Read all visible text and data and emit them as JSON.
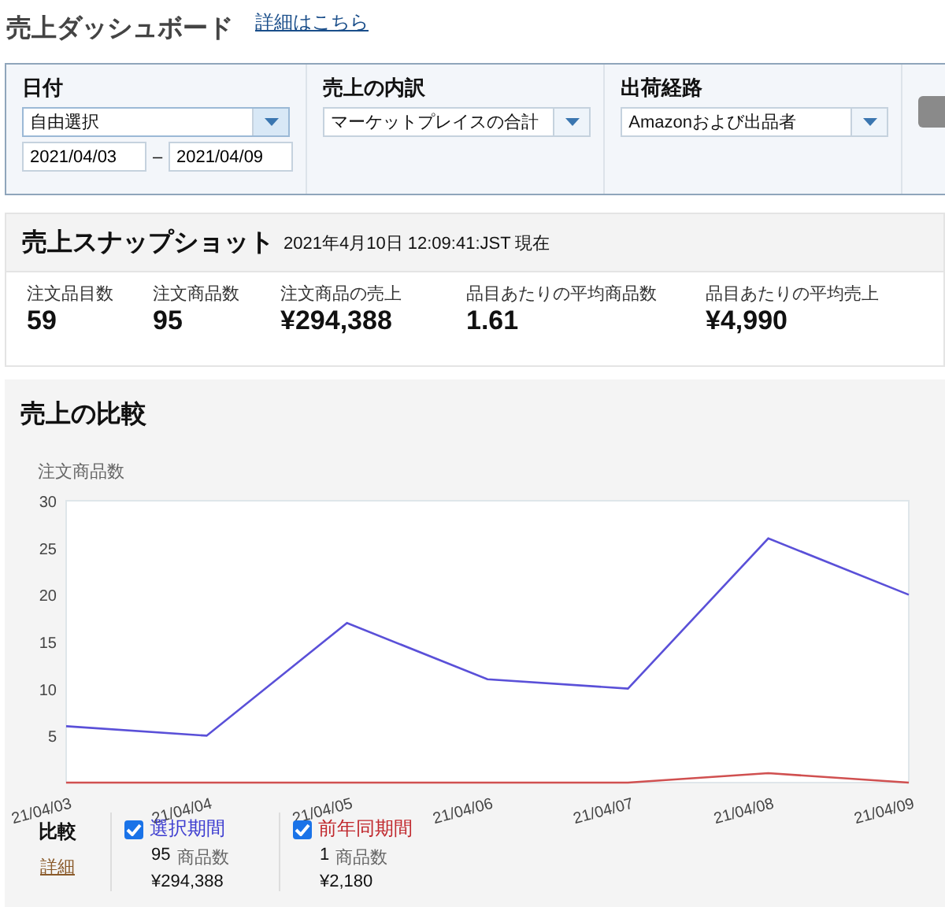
{
  "header": {
    "title": "売上ダッシュボード",
    "link": "詳細はこちら"
  },
  "filters": [
    {
      "kind": "date",
      "label": "日付",
      "select": "自由選択",
      "date_from": "2021/04/03",
      "separator": "–",
      "date_to": "2021/04/09"
    },
    {
      "kind": "select",
      "label": "売上の内訳",
      "select": "マーケットプレイスの合計"
    },
    {
      "kind": "select",
      "label": "出荷経路",
      "select": "Amazonおよび出品者"
    }
  ],
  "snapshot": {
    "title": "売上スナップショット",
    "timestamp": "2021年4月10日 12:09:41:JST 現在",
    "metrics": [
      {
        "label": "注文品目数",
        "value": "59"
      },
      {
        "label": "注文商品数",
        "value": "95"
      },
      {
        "label": "注文商品の売上",
        "value": "¥294,388"
      },
      {
        "label": "品目あたりの平均商品数",
        "value": "1.61"
      },
      {
        "label": "品目あたりの平均売上",
        "value": "¥4,990"
      }
    ]
  },
  "comparison": {
    "title": "売上の比較",
    "chart_data": {
      "type": "line",
      "ylabel": "注文商品数",
      "categories": [
        "21/04/03",
        "21/04/04",
        "21/04/05",
        "21/04/06",
        "21/04/07",
        "21/04/08",
        "21/04/09"
      ],
      "ylim": [
        0,
        30
      ],
      "yticks": [
        5,
        10,
        15,
        20,
        25,
        30
      ],
      "series": [
        {
          "name": "選択期間",
          "color": "#5a50d8",
          "values": [
            6,
            5,
            17,
            11,
            10,
            26,
            20
          ]
        },
        {
          "name": "前年同期間",
          "color": "#d05050",
          "values": [
            0,
            0,
            0,
            0,
            0,
            1,
            0
          ]
        }
      ]
    },
    "compare_label": "比較",
    "details_link": "詳細",
    "legend": [
      {
        "checked": true,
        "color": "#3b3bd0",
        "count": "95",
        "unit": "商品数",
        "amount": "¥294,388"
      },
      {
        "checked": true,
        "color": "#c0282d",
        "count": "1",
        "unit": "商品数",
        "amount": "¥2,180"
      }
    ]
  }
}
